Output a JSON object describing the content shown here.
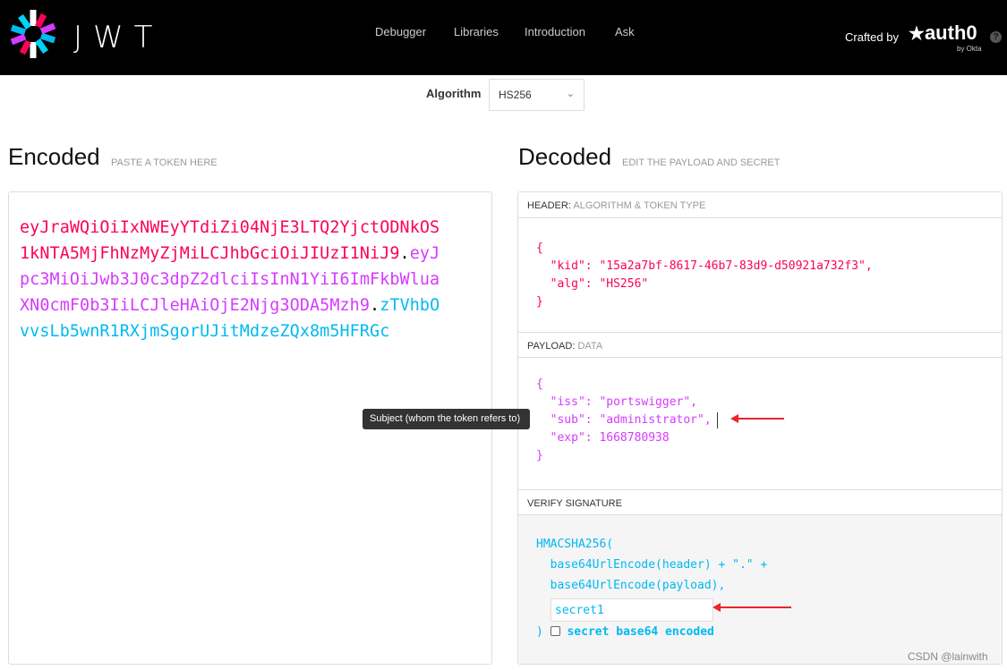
{
  "header": {
    "logo_text": "JWT",
    "nav": [
      "Debugger",
      "Libraries",
      "Introduction",
      "Ask"
    ],
    "crafted_by": "Crafted by",
    "brand": "auth0",
    "brand_sub": "by Okta",
    "help": "?"
  },
  "algorithm": {
    "label": "Algorithm",
    "selected": "HS256"
  },
  "encoded": {
    "title": "Encoded",
    "subtitle": "PASTE A TOKEN HERE",
    "header_part": "eyJraWQiOiIxNWEyYTdiZi04NjE3LTQ2YjctODNkOS1kNTA5MjFhNzMyZjMiLCJhbGciOiJIUzI1NiJ9",
    "payload_part": "eyJpc3MiOiJwb3J0c3dpZ2dlciIsInN1YiI6ImFkbWluaXN0cmF0b3IiLCJleHAiOjE2Njg3ODA5Mzh9",
    "signature_part": "zTVhbOvvsLb5wnR1RXjmSgorUJitMdzeZQx8m5HFRGc",
    "dot": "."
  },
  "decoded": {
    "title": "Decoded",
    "subtitle": "EDIT THE PAYLOAD AND SECRET",
    "header_label": "HEADER:",
    "header_label_sub": "ALGORITHM & TOKEN TYPE",
    "header_json": "{\n  \"kid\": \"15a2a7bf-8617-46b7-83d9-d50921a732f3\",\n  \"alg\": \"HS256\"\n}",
    "payload_label": "PAYLOAD:",
    "payload_label_sub": "DATA",
    "payload_json": "{\n  \"iss\": \"portswigger\",\n  \"sub\": \"administrator\",\n  \"exp\": 1668780938\n}",
    "verify_label": "VERIFY SIGNATURE",
    "verify_code": "HMACSHA256(\n  base64UrlEncode(header) + \".\" +\n  base64UrlEncode(payload),",
    "secret": "secret1",
    "close_paren": ")",
    "base64_label": "secret base64 encoded",
    "base64_checked": false
  },
  "tooltip": "Subject (whom the token refers to)",
  "watermark": "CSDN @lainwith",
  "colors": {
    "header": "#fb015b",
    "payload": "#d63aff",
    "signature": "#00b9f1",
    "annotation_arrow": "#e8262b"
  }
}
